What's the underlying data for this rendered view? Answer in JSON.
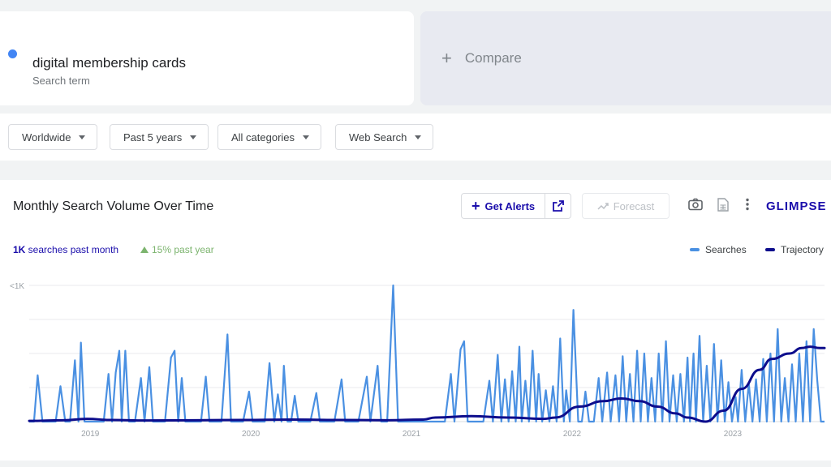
{
  "search": {
    "term": "digital membership cards",
    "sublabel": "Search term",
    "dot_color": "#4285f4"
  },
  "compare": {
    "label": "Compare"
  },
  "filters": [
    {
      "label": "Worldwide"
    },
    {
      "label": "Past 5 years"
    },
    {
      "label": "All categories"
    },
    {
      "label": "Web Search"
    }
  ],
  "chart_panel": {
    "title": "Monthly Search Volume Over Time",
    "get_alerts_label": "Get Alerts",
    "forecast_label": "Forecast",
    "brand": "GLIMPSE",
    "stat_volume": "1K",
    "stat_volume_suffix": " searches past month",
    "stat_growth": "15% past year",
    "legend": {
      "searches": "Searches",
      "trajectory": "Trajectory"
    }
  },
  "colors": {
    "accent": "#1a0dab",
    "searches": "#4a90e2",
    "trajectory": "#0d0d8c",
    "growth": "#7cb46e"
  },
  "chart_data": {
    "type": "line",
    "ylabel_tick": "<1K",
    "x_ticks": [
      "2019",
      "2020",
      "2021",
      "2022",
      "2023"
    ],
    "xlim": [
      2018.6,
      2023.55
    ],
    "ylim": [
      0,
      1000
    ],
    "grid": true,
    "legend_placement": "top-right",
    "series": [
      {
        "name": "Searches",
        "points": [
          [
            2018.62,
            0
          ],
          [
            2018.66,
            0
          ],
          [
            2018.69,
            340
          ],
          [
            2018.73,
            0
          ],
          [
            2018.8,
            0
          ],
          [
            2018.84,
            0
          ],
          [
            2018.88,
            260
          ],
          [
            2018.92,
            0
          ],
          [
            2018.96,
            0
          ],
          [
            2019,
            450
          ],
          [
            2019.03,
            0
          ],
          [
            2019.05,
            580
          ],
          [
            2019.08,
            0
          ],
          [
            2019.12,
            0
          ],
          [
            2019.15,
            0
          ],
          [
            2019.2,
            0
          ],
          [
            2019.24,
            0
          ],
          [
            2019.28,
            350
          ],
          [
            2019.31,
            0
          ],
          [
            2019.34,
            360
          ],
          [
            2019.37,
            520
          ],
          [
            2019.39,
            0
          ],
          [
            2019.42,
            520
          ],
          [
            2019.45,
            0
          ],
          [
            2019.5,
            0
          ],
          [
            2019.55,
            320
          ],
          [
            2019.58,
            0
          ],
          [
            2019.62,
            400
          ],
          [
            2019.65,
            0
          ],
          [
            2019.7,
            0
          ],
          [
            2019.75,
            0
          ],
          [
            2019.8,
            470
          ],
          [
            2019.83,
            520
          ],
          [
            2019.86,
            0
          ],
          [
            2019.89,
            320
          ],
          [
            2019.92,
            0
          ],
          [
            2019.95,
            0
          ],
          [
            2019.98,
            0
          ],
          [
            2020.05,
            0
          ],
          [
            2020.09,
            330
          ],
          [
            2020.12,
            0
          ],
          [
            2020.18,
            0
          ],
          [
            2020.22,
            0
          ],
          [
            2020.27,
            640
          ],
          [
            2020.3,
            0
          ],
          [
            2020.35,
            0
          ],
          [
            2020.4,
            0
          ],
          [
            2020.45,
            220
          ],
          [
            2020.48,
            0
          ],
          [
            2020.52,
            0
          ],
          [
            2020.58,
            0
          ],
          [
            2020.62,
            430
          ],
          [
            2020.66,
            0
          ],
          [
            2020.69,
            200
          ],
          [
            2020.72,
            0
          ],
          [
            2020.74,
            410
          ],
          [
            2020.77,
            0
          ],
          [
            2020.8,
            0
          ],
          [
            2020.83,
            190
          ],
          [
            2020.86,
            0
          ],
          [
            2020.9,
            0
          ],
          [
            2020.96,
            0
          ],
          [
            2021.01,
            210
          ],
          [
            2021.04,
            0
          ],
          [
            2021.1,
            0
          ],
          [
            2021.16,
            0
          ],
          [
            2021.22,
            310
          ],
          [
            2021.25,
            0
          ],
          [
            2021.3,
            0
          ],
          [
            2021.36,
            0
          ],
          [
            2021.43,
            330
          ],
          [
            2021.46,
            0
          ],
          [
            2021.52,
            410
          ],
          [
            2021.55,
            0
          ],
          [
            2021.6,
            0
          ],
          [
            2021.65,
            1000
          ],
          [
            2021.69,
            0
          ],
          [
            2021.72,
            0
          ],
          [
            2021.78,
            0
          ],
          [
            2021.83,
            0
          ],
          [
            2021.88,
            0
          ],
          [
            2021.93,
            0
          ],
          [
            2021.98,
            0
          ],
          [
            2022.03,
            0
          ],
          [
            2022.08,
            0
          ],
          [
            2022.13,
            350
          ],
          [
            2022.16,
            0
          ],
          [
            2022.21,
            530
          ],
          [
            2022.24,
            590
          ],
          [
            2022.27,
            0
          ],
          [
            2022.32,
            0
          ],
          [
            2022.36,
            0
          ],
          [
            2022.4,
            0
          ],
          [
            2022.45,
            300
          ],
          [
            2022.48,
            0
          ],
          [
            2022.52,
            490
          ],
          [
            2022.55,
            0
          ],
          [
            2022.58,
            310
          ],
          [
            2022.61,
            0
          ],
          [
            2022.64,
            370
          ],
          [
            2022.67,
            0
          ],
          [
            2022.7,
            550
          ],
          [
            2022.72,
            0
          ],
          [
            2022.75,
            300
          ],
          [
            2022.78,
            0
          ],
          [
            2022.81,
            520
          ],
          [
            2022.84,
            0
          ],
          [
            2022.86,
            350
          ],
          [
            2022.89,
            0
          ],
          [
            2022.92,
            230
          ],
          [
            2022.95,
            0
          ],
          [
            2022.98,
            260
          ],
          [
            2023.01,
            0
          ],
          [
            2023.04,
            610
          ],
          [
            2023.07,
            0
          ],
          [
            2023.09,
            230
          ],
          [
            2023.12,
            0
          ],
          [
            2023.15,
            820
          ],
          [
            2023.19,
            0
          ],
          [
            2023.22,
            0
          ],
          [
            2023.25,
            220
          ],
          [
            2023.28,
            0
          ],
          [
            2023.32,
            0
          ],
          [
            2023.36,
            320
          ],
          [
            2023.39,
            0
          ],
          [
            2023.43,
            360
          ],
          [
            2023.46,
            0
          ],
          [
            2023.5,
            340
          ],
          [
            2023.53,
            0
          ],
          [
            2023.56,
            480
          ],
          [
            2023.59,
            0
          ],
          [
            2023.62,
            350
          ],
          [
            2023.65,
            0
          ],
          [
            2023.68,
            520
          ],
          [
            2023.71,
            0
          ],
          [
            2023.74,
            500
          ],
          [
            2023.77,
            0
          ],
          [
            2023.8,
            320
          ],
          [
            2023.83,
            0
          ],
          [
            2023.86,
            500
          ],
          [
            2023.89,
            0
          ],
          [
            2023.92,
            590
          ],
          [
            2023.95,
            0
          ],
          [
            2023.98,
            340
          ],
          [
            2024.01,
            0
          ],
          [
            2024.04,
            350
          ],
          [
            2024.07,
            0
          ],
          [
            2024.1,
            470
          ],
          [
            2024.12,
            0
          ],
          [
            2024.15,
            500
          ],
          [
            2024.17,
            0
          ],
          [
            2024.2,
            630
          ],
          [
            2024.23,
            0
          ],
          [
            2024.26,
            410
          ],
          [
            2024.29,
            0
          ],
          [
            2024.32,
            570
          ],
          [
            2024.35,
            0
          ],
          [
            2024.38,
            450
          ],
          [
            2024.41,
            0
          ],
          [
            2024.44,
            290
          ],
          [
            2024.47,
            0
          ],
          [
            2024.5,
            180
          ],
          [
            2024.52,
            0
          ],
          [
            2024.55,
            380
          ],
          [
            2024.58,
            0
          ],
          [
            2024.61,
            280
          ],
          [
            2024.64,
            0
          ],
          [
            2024.67,
            310
          ],
          [
            2024.7,
            0
          ],
          [
            2024.73,
            460
          ],
          [
            2024.76,
            0
          ],
          [
            2024.79,
            500
          ],
          [
            2024.82,
            0
          ],
          [
            2024.85,
            680
          ],
          [
            2024.88,
            0
          ],
          [
            2024.91,
            320
          ],
          [
            2024.94,
            0
          ],
          [
            2024.97,
            420
          ],
          [
            2025,
            0
          ],
          [
            2025.03,
            500
          ],
          [
            2025.06,
            0
          ],
          [
            2025.09,
            590
          ],
          [
            2025.12,
            0
          ],
          [
            2025.15,
            680
          ],
          [
            2025.18,
            300
          ],
          [
            2025.21,
            0
          ],
          [
            2025.24,
            0
          ]
        ]
      },
      {
        "name": "Trajectory",
        "points": [
          [
            2018.62,
            5
          ],
          [
            2018.9,
            10
          ],
          [
            2019.1,
            20
          ],
          [
            2019.3,
            12
          ],
          [
            2019.6,
            8
          ],
          [
            2020.0,
            10
          ],
          [
            2020.4,
            12
          ],
          [
            2020.8,
            15
          ],
          [
            2021.2,
            12
          ],
          [
            2021.6,
            10
          ],
          [
            2021.9,
            15
          ],
          [
            2022.0,
            30
          ],
          [
            2022.3,
            40
          ],
          [
            2022.6,
            30
          ],
          [
            2022.9,
            20
          ],
          [
            2023.0,
            30
          ],
          [
            2023.2,
            110
          ],
          [
            2023.4,
            150
          ],
          [
            2023.55,
            170
          ],
          [
            2023.7,
            150
          ],
          [
            2023.85,
            110
          ],
          [
            2024.0,
            60
          ],
          [
            2024.1,
            30
          ],
          [
            2024.25,
            0
          ],
          [
            2024.4,
            80
          ],
          [
            2024.55,
            240
          ],
          [
            2024.7,
            380
          ],
          [
            2024.8,
            460
          ],
          [
            2024.95,
            500
          ],
          [
            2025.05,
            540
          ],
          [
            2025.12,
            550
          ],
          [
            2025.2,
            540
          ],
          [
            2025.24,
            540
          ]
        ]
      }
    ]
  }
}
